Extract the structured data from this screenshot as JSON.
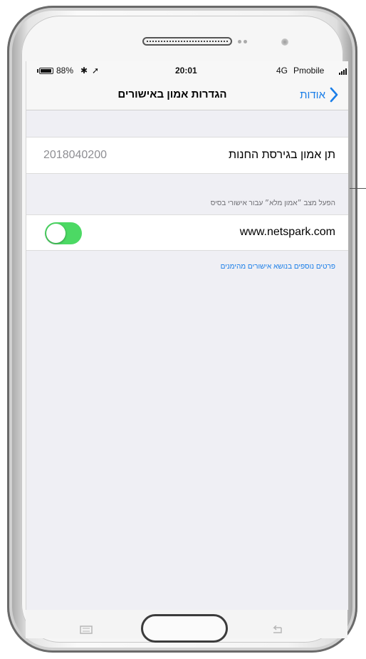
{
  "status_bar": {
    "battery": "88%",
    "bluetooth_icon": "bluetooth-icon",
    "location_icon": "location-arrow-icon",
    "time": "20:01",
    "network": "4G",
    "carrier": "Pmobile",
    "signal_icon": "signal-bars-icon"
  },
  "nav": {
    "title": "הגדרות אמון באישורים",
    "back_label": "אודות",
    "back_icon": "chevron-right-icon"
  },
  "settings": {
    "trust_row": {
      "label": "תן אמון בגירסת החנות",
      "value": "2018040200"
    },
    "section_header": "הפעל מצב ״אמון מלא״ עבור אישורי בסיס",
    "certificate_row": {
      "label": "www.netspark.com",
      "toggle_on": true
    },
    "more_info_link": "פרטים נוספים בנושא אישורים מהימנים"
  },
  "colors": {
    "accent": "#1a7ee8",
    "toggle_on": "#4cd964",
    "background": "#efeff4"
  }
}
